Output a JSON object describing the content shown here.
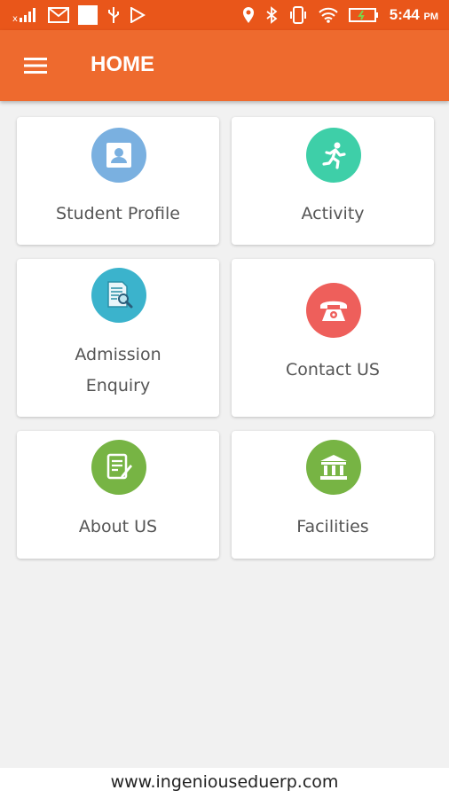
{
  "status_bar": {
    "time": "5:44",
    "ampm": "PM",
    "left_icons": [
      "signal-icon",
      "gmail-icon",
      "notification-icon",
      "usb-icon",
      "play-store-icon"
    ],
    "right_icons": [
      "location-icon",
      "bluetooth-icon",
      "vibrate-icon",
      "wifi-icon",
      "battery-icon"
    ],
    "color": "#e9561a"
  },
  "app_bar": {
    "title": "HOME",
    "menu_icon": "hamburger-menu-icon",
    "color": "#ee6a2e"
  },
  "tiles": [
    {
      "label_lines": [
        "Student Profile"
      ],
      "icon": "profile-icon",
      "color": "#7ab0e0"
    },
    {
      "label_lines": [
        "Activity"
      ],
      "icon": "running-person-icon",
      "color": "#3ecfa8"
    },
    {
      "label_lines": [
        "Admission",
        "Enquiry"
      ],
      "icon": "document-search-icon",
      "color": "#3bb3cc"
    },
    {
      "label_lines": [
        "Contact US"
      ],
      "icon": "telephone-icon",
      "color": "#ee5f5b"
    },
    {
      "label_lines": [
        "About US"
      ],
      "icon": "document-edit-icon",
      "color": "#77b444"
    },
    {
      "label_lines": [
        "Facilities"
      ],
      "icon": "institution-icon",
      "color": "#77b444"
    }
  ],
  "footer": {
    "text": "www.ingeniouseduerp.com"
  }
}
